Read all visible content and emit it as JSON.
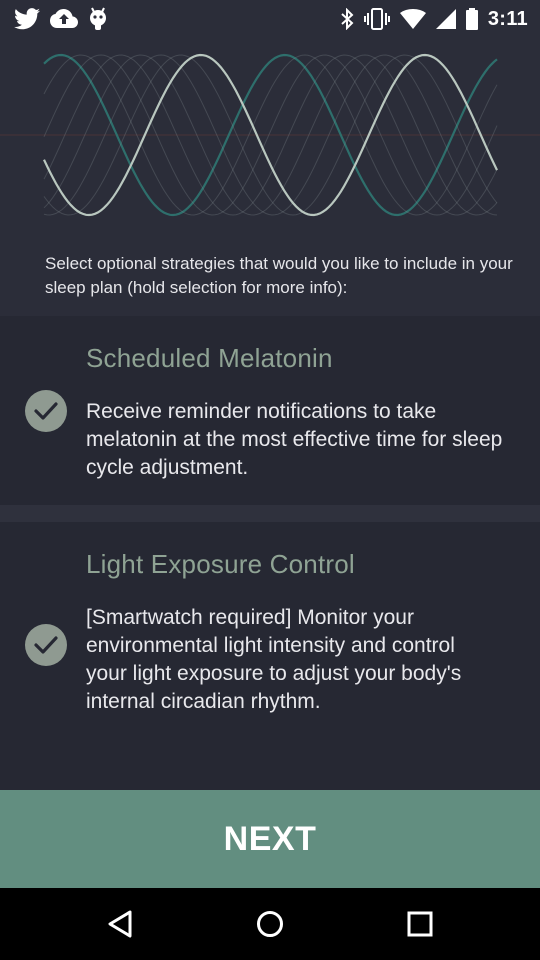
{
  "status_bar": {
    "left_icons": [
      "twitter-icon",
      "cloud-upload-icon",
      "android-icon"
    ],
    "right_icons": [
      "bluetooth-icon",
      "vibrate-icon",
      "wifi-icon",
      "signal-icon",
      "battery-icon"
    ],
    "time": "3:11"
  },
  "intro_text": "Select optional strategies that would you like to include in your sleep plan (hold selection for more info):",
  "options": [
    {
      "title": "Scheduled Melatonin",
      "description": "Receive reminder notifications to take melatonin at the most effective time for sleep cycle adjustment.",
      "checked": true
    },
    {
      "title": "Light Exposure Control",
      "description": "[Smartwatch required] Monitor your environmental light intensity and control your light exposure to adjust your body's internal circadian rhythm.",
      "checked": true
    }
  ],
  "next_button": {
    "label": "NEXT"
  },
  "nav_bar": {
    "icons": [
      "back-icon",
      "home-icon",
      "recent-apps-icon"
    ]
  },
  "colors": {
    "background": "#2b2d39",
    "card": "#262833",
    "accent_title": "#8fa394",
    "button": "#628e80",
    "check_circle": "#8f9a91",
    "wave_dark": "#2e6f6c",
    "wave_light": "#b9c7bf"
  }
}
